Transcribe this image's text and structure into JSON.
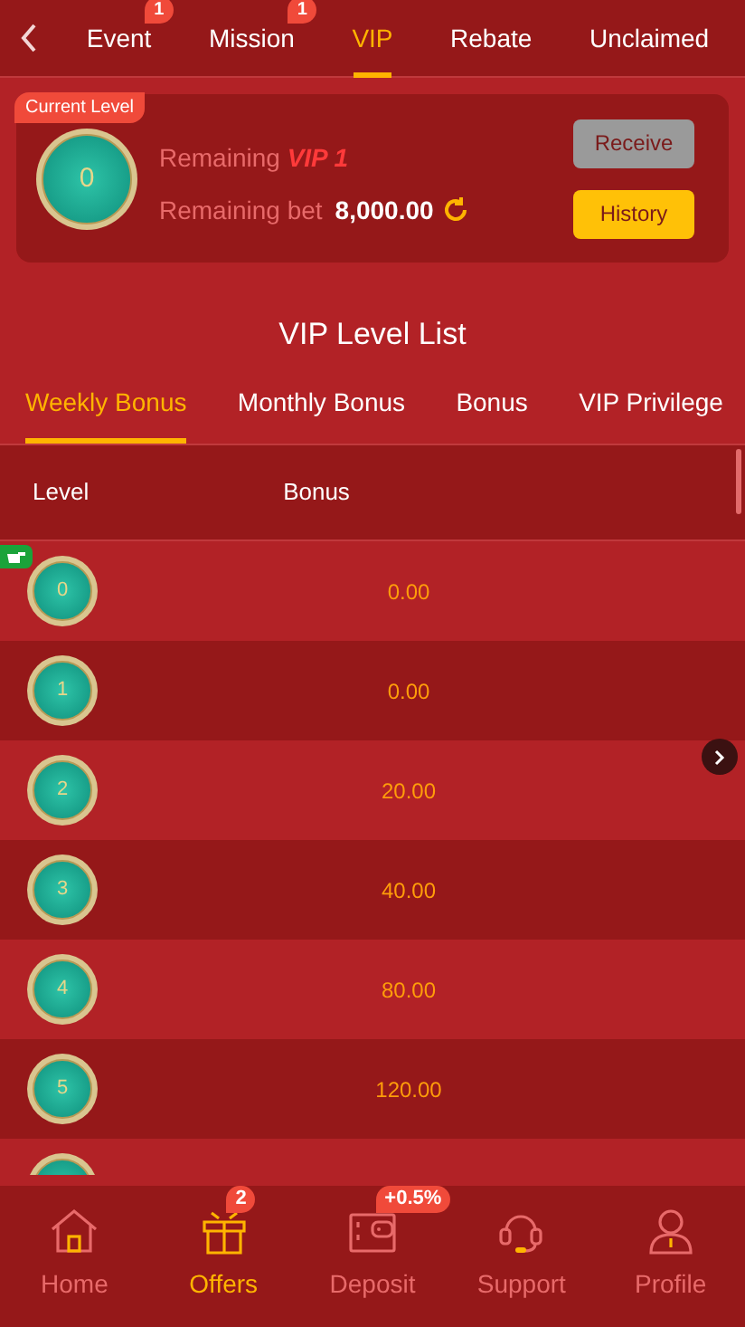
{
  "top_tabs": [
    {
      "label": "Event",
      "selected": false,
      "badge": "1"
    },
    {
      "label": "Mission",
      "selected": false,
      "badge": "1"
    },
    {
      "label": "VIP",
      "selected": true
    },
    {
      "label": "Rebate",
      "selected": false
    },
    {
      "label": "Unclaimed",
      "selected": false
    }
  ],
  "current_level": {
    "tag": "Current Level",
    "medal": "0",
    "remaining_label": "Remaining",
    "remaining_target": "VIP 1",
    "bet_label": "Remaining bet",
    "bet_value": "8,000.00",
    "buttons": [
      {
        "label": "Receive",
        "disabled": true
      },
      {
        "label": "History",
        "disabled": false
      }
    ]
  },
  "list_title": "VIP Level List",
  "bonus_tabs": [
    {
      "label": "Weekly Bonus",
      "selected": true
    },
    {
      "label": "Monthly Bonus",
      "selected": false
    },
    {
      "label": "Bonus",
      "selected": false
    },
    {
      "label": "VIP Privilege",
      "selected": false
    }
  ],
  "table": {
    "columns": [
      "Level",
      "Bonus"
    ],
    "rows": [
      {
        "kind": "row",
        "level": "0",
        "bonus": "0.00",
        "current": true
      },
      {
        "kind": "row",
        "level": "1",
        "bonus": "0.00",
        "current": false
      },
      {
        "kind": "row",
        "level": "2",
        "bonus": "20.00",
        "current": false
      },
      {
        "kind": "row",
        "level": "3",
        "bonus": "40.00",
        "current": false
      },
      {
        "kind": "row",
        "level": "4",
        "bonus": "80.00",
        "current": false
      },
      {
        "kind": "row",
        "level": "5",
        "bonus": "120.00",
        "current": false
      },
      {
        "kind": "partial"
      }
    ]
  },
  "bottom_nav": [
    {
      "label": "Home",
      "selected": false
    },
    {
      "label": "Offers",
      "selected": true,
      "badge": "2"
    },
    {
      "label": "Deposit",
      "selected": false,
      "badge": "+0.5%"
    },
    {
      "label": "Support",
      "selected": false
    },
    {
      "label": "Profile",
      "selected": false
    }
  ]
}
